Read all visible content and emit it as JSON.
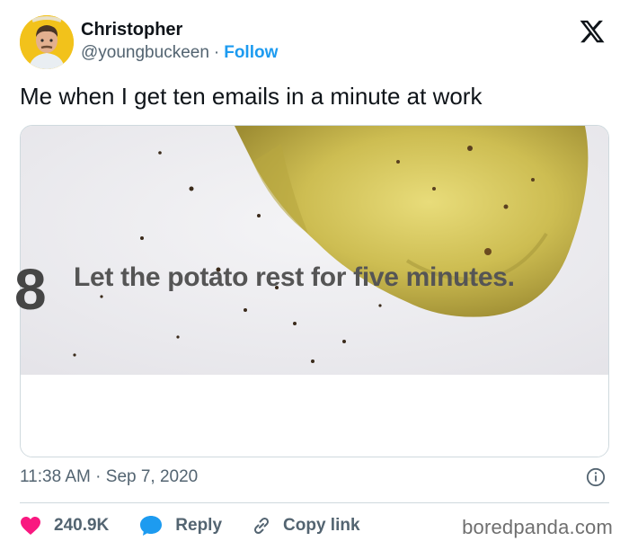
{
  "author": {
    "display_name": "Christopher",
    "handle": "@youngbuckeen",
    "separator": "·",
    "follow_label": "Follow",
    "avatar_icon": "person-avatar"
  },
  "platform": {
    "logo_icon": "x-logo-icon"
  },
  "tweet": {
    "text": "Me when I get ten emails in a minute at work"
  },
  "media": {
    "image_icon": "baked-potato-photo",
    "step_number": "8",
    "step_text": "Let the potato rest for five minutes."
  },
  "meta": {
    "time": "11:38 AM",
    "separator": "·",
    "date": "Sep 7, 2020",
    "info_icon": "info-icon"
  },
  "actions": {
    "like_count": "240.9K",
    "reply_label": "Reply",
    "copy_label": "Copy link"
  },
  "watermark": "boredpanda.com",
  "colors": {
    "accent": "#1d9bf0",
    "like": "#f91880",
    "muted": "#536471",
    "text": "#0f1419",
    "border": "#cfd9de",
    "avatar_bg": "#f2c21b"
  }
}
